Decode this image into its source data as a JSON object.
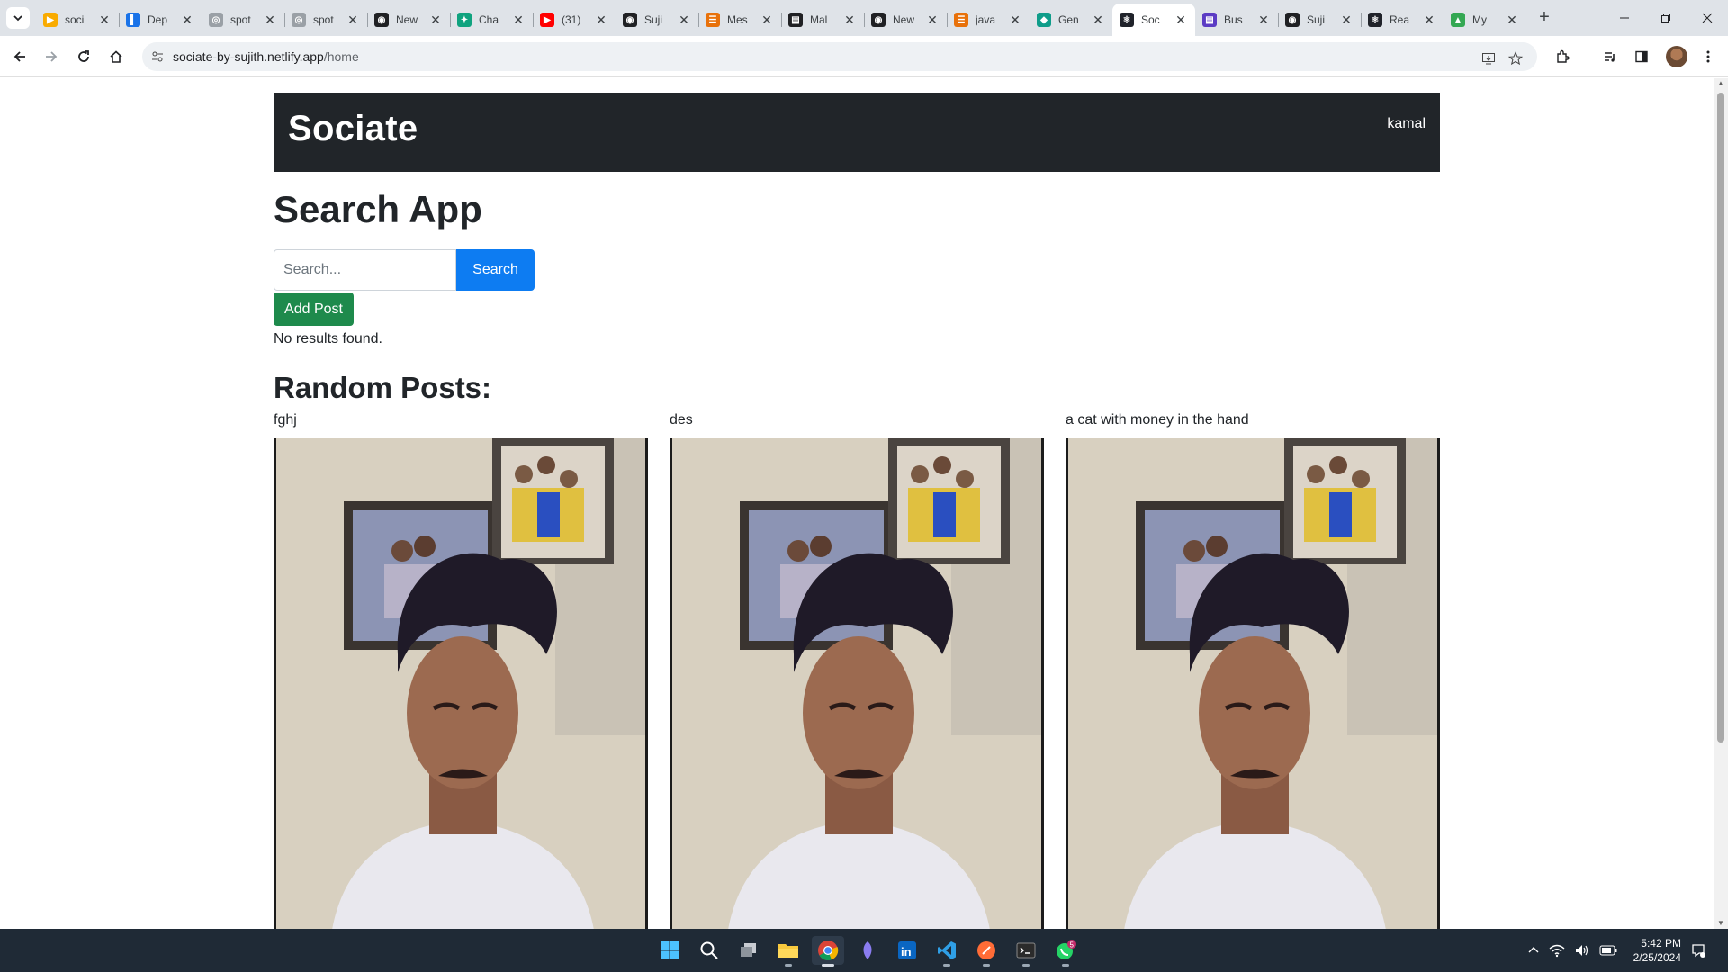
{
  "browser": {
    "tabs": [
      {
        "label": "soci",
        "color": "#f9ab00",
        "glyph": "▶",
        "active": false
      },
      {
        "label": "Dep",
        "color": "#1a73e8",
        "glyph": "▌",
        "active": false
      },
      {
        "label": "spot",
        "color": "#9aa0a6",
        "glyph": "◎",
        "active": false
      },
      {
        "label": "spot",
        "color": "#9aa0a6",
        "glyph": "◎",
        "active": false
      },
      {
        "label": "New",
        "color": "#202124",
        "glyph": "◉",
        "active": false
      },
      {
        "label": "Cha",
        "color": "#10a37f",
        "glyph": "✦",
        "active": false
      },
      {
        "label": "(31)",
        "color": "#ff0000",
        "glyph": "▶",
        "active": false
      },
      {
        "label": "Suji",
        "color": "#202124",
        "glyph": "◉",
        "active": false
      },
      {
        "label": "Mes",
        "color": "#e8710a",
        "glyph": "☰",
        "active": false
      },
      {
        "label": "Mal",
        "color": "#202124",
        "glyph": "▤",
        "active": false
      },
      {
        "label": "New",
        "color": "#202124",
        "glyph": "◉",
        "active": false
      },
      {
        "label": "java",
        "color": "#e8710a",
        "glyph": "☰",
        "active": false
      },
      {
        "label": "Gen",
        "color": "#0f9d8a",
        "glyph": "◆",
        "active": false
      },
      {
        "label": "Soc",
        "color": "#20232a",
        "glyph": "⚛",
        "active": true
      },
      {
        "label": "Bus",
        "color": "#5c3cc4",
        "glyph": "▤",
        "active": false
      },
      {
        "label": "Suji",
        "color": "#202124",
        "glyph": "◉",
        "active": false
      },
      {
        "label": "Rea",
        "color": "#20232a",
        "glyph": "⚛",
        "active": false
      },
      {
        "label": "My",
        "color": "#34a853",
        "glyph": "▲",
        "active": false
      }
    ],
    "new_tab": "+",
    "url_host": "sociate-by-sujith.netlify.app",
    "url_path": "/home"
  },
  "app": {
    "brand": "Sociate",
    "user": "kamal",
    "page_title": "Search App",
    "search_placeholder": "Search...",
    "search_value": "",
    "search_button": "Search",
    "add_post_button": "Add Post",
    "no_results": "No results found.",
    "section_title": "Random Posts:",
    "posts": [
      {
        "title": "fghj"
      },
      {
        "title": "des"
      },
      {
        "title": "a cat with money in the hand"
      }
    ]
  },
  "taskbar": {
    "time": "5:42 PM",
    "date": "2/25/2024",
    "whatsapp_badge": "5"
  },
  "colors": {
    "navbar_bg": "#212529",
    "search_button": "#0d7cf2",
    "add_post_button": "#1e8a4c",
    "taskbar_bg": "#1f2a36"
  }
}
